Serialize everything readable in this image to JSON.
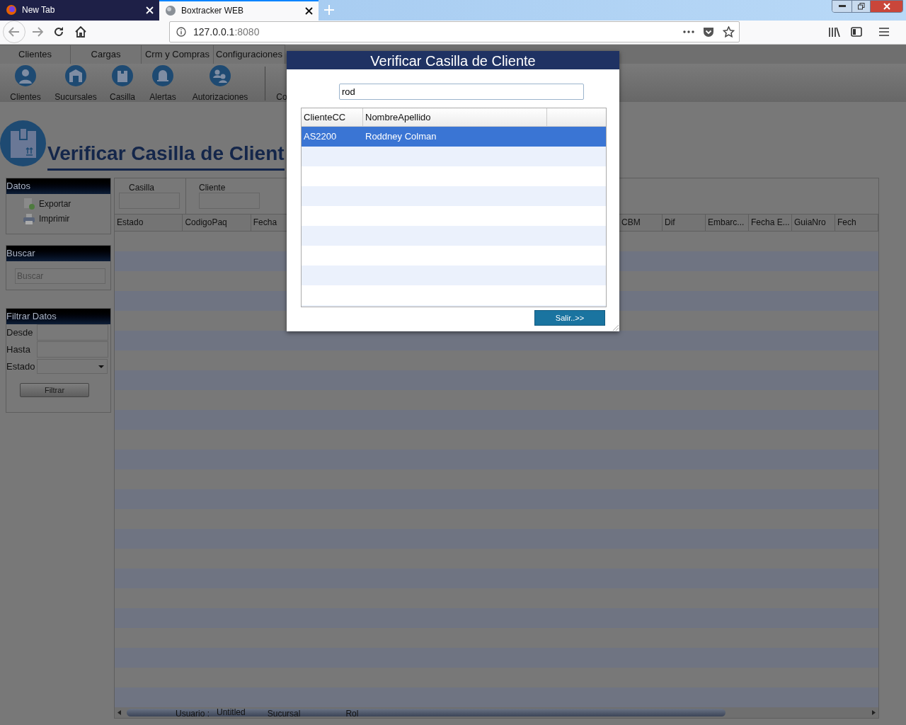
{
  "browser": {
    "tabs": [
      {
        "title": "New Tab",
        "selected": false
      },
      {
        "title": "Boxtracker WEB",
        "selected": true
      }
    ],
    "url": {
      "host": "127.0.0.1",
      "port": ":8080"
    }
  },
  "menu_tabs": [
    {
      "label": "Clientes",
      "selected": false
    },
    {
      "label": "Cargas",
      "selected": false
    },
    {
      "label": "Crm y Compras",
      "selected": false
    },
    {
      "label": "Configuraciones",
      "selected": false
    }
  ],
  "toolbar": [
    {
      "label": "Clientes",
      "kind": "person"
    },
    {
      "label": "Sucursales",
      "kind": "building"
    },
    {
      "label": "Casilla",
      "kind": "box"
    },
    {
      "label": "Alertas",
      "kind": "bell"
    },
    {
      "label": "Autorizaciones",
      "kind": "people"
    },
    {
      "label": "Co",
      "kind": "other"
    }
  ],
  "page_title": "Verificar Casilla de Client",
  "datos_panel": {
    "title": "Datos",
    "actions": [
      {
        "label": "Exportar",
        "kind": "export"
      },
      {
        "label": "Imprimir",
        "kind": "print"
      }
    ]
  },
  "buscar_panel": {
    "title": "Buscar",
    "placeholder": "Buscar"
  },
  "filtrar_panel": {
    "title": "Filtrar Datos",
    "fields": [
      {
        "label": "Desde",
        "kind": "text"
      },
      {
        "label": "Hasta",
        "kind": "text"
      },
      {
        "label": "Estado",
        "kind": "select"
      }
    ],
    "button": "Filtrar"
  },
  "filters": [
    {
      "label": "Casilla"
    },
    {
      "label": "Cliente"
    }
  ],
  "grid": {
    "columns_left": [
      "Estado",
      "CodigoPaq",
      "Fecha"
    ],
    "columns_right": [
      "CBM",
      "Dif",
      "Embarc...",
      "Fecha E...",
      "GuiaNro",
      "Fech"
    ]
  },
  "status_bar": {
    "user_label": "Usuario :",
    "user": "Untitled",
    "branch_label": "Sucursal",
    "role_label": "Rol"
  },
  "modal": {
    "title": "Verificar Casilla de Cliente",
    "search_value": "rod",
    "columns": [
      "ClienteCC",
      "NombreApellido"
    ],
    "rows": [
      {
        "cells": [
          "AS2200",
          "Roddney Colman"
        ],
        "selected": true
      }
    ],
    "button": "Salir..>>"
  }
}
